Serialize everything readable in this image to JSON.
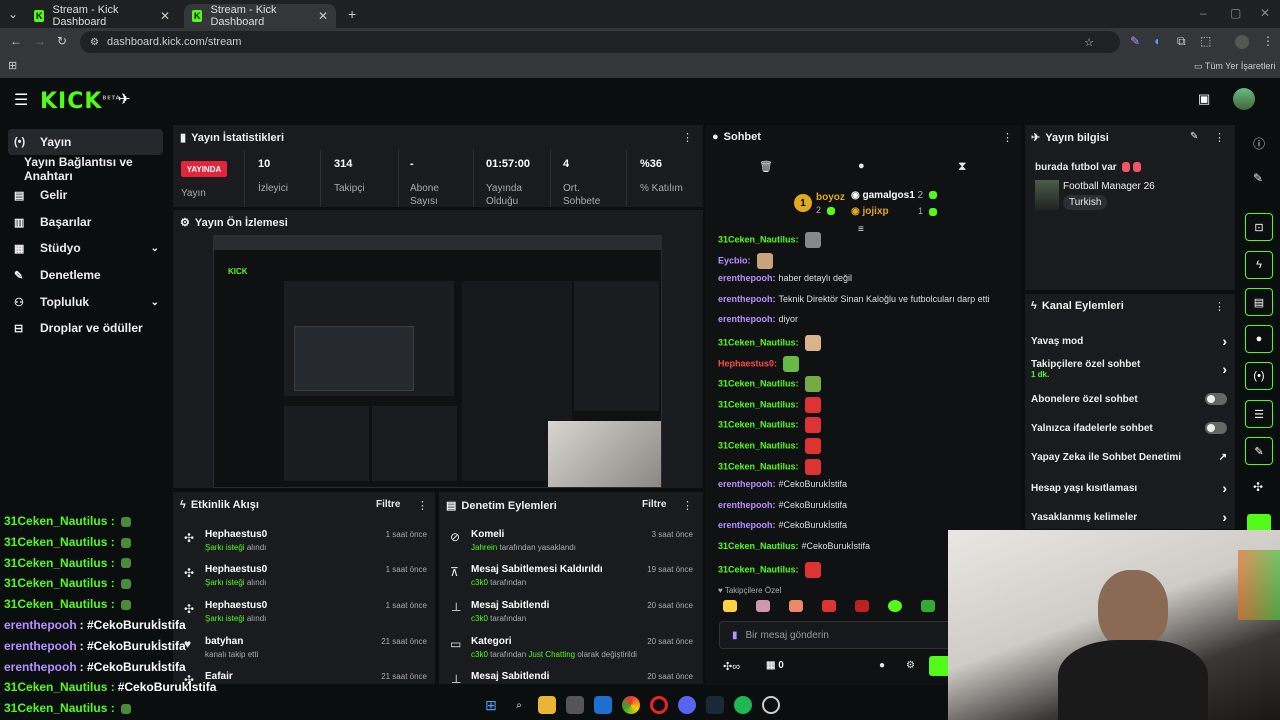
{
  "browser": {
    "tabs": [
      {
        "title": "Stream - Kick Dashboard"
      },
      {
        "title": "Stream - Kick Dashboard"
      }
    ],
    "url": "dashboard.kick.com/stream",
    "bookmarks_label": "Tüm Yer İşaretleri"
  },
  "header": {
    "logo": "KICK",
    "beta": "BETA"
  },
  "sidebar": {
    "items": [
      {
        "label": "Yayın",
        "icon": "broadcast-icon"
      },
      {
        "label": "Yayın Bağlantısı ve Anahtarı",
        "icon": ""
      },
      {
        "label": "Gelir",
        "icon": "money-icon"
      },
      {
        "label": "Başarılar",
        "icon": "trophy-icon"
      },
      {
        "label": "Stüdyo",
        "icon": "studio-icon"
      },
      {
        "label": "Denetleme",
        "icon": "wrench-icon"
      },
      {
        "label": "Topluluk",
        "icon": "people-icon"
      },
      {
        "label": "Droplar ve ödüller",
        "icon": "gift-icon"
      }
    ]
  },
  "stats": {
    "title": "Yayın İstatistikleri",
    "live_badge": "YAYINDA",
    "live_label": "Yayın",
    "items": [
      {
        "value": "10",
        "label": "İzleyici"
      },
      {
        "value": "314",
        "label": "Takipçi"
      },
      {
        "value": "-",
        "label": "Abone Sayısı"
      },
      {
        "value": "01:57:00",
        "label": "Yayında Olduğu"
      },
      {
        "value": "4",
        "label": "Ort. Sohbete"
      },
      {
        "value": "%36",
        "label": "% Katılım"
      }
    ]
  },
  "preview": {
    "title": "Yayın Ön İzlemesi"
  },
  "activity": {
    "title": "Etkinlik Akışı",
    "filter": "Filtre",
    "rows": [
      {
        "user": "Hephaestus0",
        "detail_pre": "Şarkı isteği",
        "detail_post": "alındı",
        "time": "1 saat önce"
      },
      {
        "user": "Hephaestus0",
        "detail_pre": "Şarkı isteği",
        "detail_post": "alındı",
        "time": "1 saat önce"
      },
      {
        "user": "Hephaestus0",
        "detail_pre": "Şarkı isteği",
        "detail_post": "alındı",
        "time": "1 saat önce"
      },
      {
        "user": "batyhan",
        "detail_pre": "",
        "detail_post": "kanalı takip etti",
        "time": "21 saat önce"
      },
      {
        "user": "Eafair",
        "detail_pre": "",
        "detail_post": "",
        "time": "21 saat önce"
      }
    ]
  },
  "audit": {
    "title": "Denetim Eylemleri",
    "filter": "Filtre",
    "rows": [
      {
        "title": "Komeli",
        "actor": "Jahrein",
        "detail": "tarafından yasaklandı",
        "time": "3 saat önce",
        "extra": "",
        "extra2": ""
      },
      {
        "title": "Mesaj Sabitlemesi Kaldırıldı",
        "actor": "c3k0",
        "detail": "tarafından",
        "time": "19 saat önce",
        "extra": "",
        "extra2": ""
      },
      {
        "title": "Mesaj Sabitlendi",
        "actor": "c3k0",
        "detail": "tarafından",
        "time": "20 saat önce",
        "extra": "",
        "extra2": ""
      },
      {
        "title": "Kategori",
        "actor": "c3k0",
        "detail": "tarafından",
        "time": "20 saat önce",
        "extra": "Just Chatting",
        "extra2": "olarak değiştirildi"
      },
      {
        "title": "Mesaj Sabitlendi",
        "actor": "",
        "detail": "",
        "time": "20 saat önce",
        "extra": "",
        "extra2": ""
      }
    ]
  },
  "chat": {
    "title": "Sohbet",
    "leaders": [
      {
        "rank": "1",
        "name": "boyoz",
        "count": "2"
      },
      {
        "rank": "",
        "name": "gamalgos1",
        "count": "2"
      },
      {
        "rank": "",
        "name": "jojixp",
        "count": "1"
      }
    ],
    "messages": [
      {
        "user": "31Ceken_Nautilus:",
        "text": "",
        "color": "green"
      },
      {
        "user": "Eycbio:",
        "text": "",
        "color": "purple"
      },
      {
        "user": "erenthepooh:",
        "text": "haber detaylı değil",
        "color": "purple"
      },
      {
        "user": "erenthepooh:",
        "text": "Teknik Direktör Sinan Kaloğlu ve futbolcuları darp etti",
        "color": "purple"
      },
      {
        "user": "erenthepooh:",
        "text": "diyor",
        "color": "purple"
      },
      {
        "user": "31Ceken_Nautilus:",
        "text": "",
        "color": "green"
      },
      {
        "user": "Hephaestus0:",
        "text": "",
        "color": "red"
      },
      {
        "user": "31Ceken_Nautilus:",
        "text": "",
        "color": "green"
      },
      {
        "user": "31Ceken_Nautilus:",
        "text": "",
        "color": "green"
      },
      {
        "user": "31Ceken_Nautilus:",
        "text": "",
        "color": "green"
      },
      {
        "user": "31Ceken_Nautilus:",
        "text": "",
        "color": "green"
      },
      {
        "user": "31Ceken_Nautilus:",
        "text": "",
        "color": "green"
      },
      {
        "user": "erenthepooh:",
        "text": "#CekoBurukİstifa",
        "color": "purple"
      },
      {
        "user": "erenthepooh:",
        "text": "#CekoBurukİstifa",
        "color": "purple"
      },
      {
        "user": "erenthepooh:",
        "text": "#CekoBurukİstifa",
        "color": "purple"
      },
      {
        "user": "31Ceken_Nautilus:",
        "text": "#CekoBurukİstifa",
        "color": "green"
      },
      {
        "user": "31Ceken_Nautilus:",
        "text": "",
        "color": "green"
      }
    ],
    "followers_only": "Takipçilere Özel",
    "input_placeholder": "Bir mesaj gönderin",
    "counter": "0"
  },
  "stream_info": {
    "title": "Yayın bilgisi",
    "stream_title": "burada futbol var",
    "category": "Football Manager 26",
    "tag": "Turkish"
  },
  "channel_actions": {
    "title": "Kanal Eylemleri",
    "items": [
      {
        "label": "Yavaş mod",
        "sub": "",
        "kind": "arrow"
      },
      {
        "label": "Takipçilere özel sohbet",
        "sub": "1 dk.",
        "kind": "arrow"
      },
      {
        "label": "Abonelere özel sohbet",
        "sub": "",
        "kind": "toggle"
      },
      {
        "label": "Yalnızca ifadelerle sohbet",
        "sub": "",
        "kind": "toggle"
      },
      {
        "label": "Yapay Zeka ile Sohbet Denetimi",
        "sub": "",
        "kind": "external"
      },
      {
        "label": "Hesap yaşı kısıtlaması",
        "sub": "",
        "kind": "arrow"
      },
      {
        "label": "Yasaklanmış kelimeler",
        "sub": "",
        "kind": "arrow"
      }
    ]
  },
  "overlay_chat": [
    {
      "user": "31Ceken_Nautilus :",
      "text": "",
      "color": "green"
    },
    {
      "user": "31Ceken_Nautilus :",
      "text": "",
      "color": "green"
    },
    {
      "user": "31Ceken_Nautilus :",
      "text": "",
      "color": "green"
    },
    {
      "user": "31Ceken_Nautilus :",
      "text": "",
      "color": "green"
    },
    {
      "user": "31Ceken_Nautilus :",
      "text": "",
      "color": "green"
    },
    {
      "user": "erenthepooh",
      "text": ": #CekoBurukİstifa",
      "color": "purple"
    },
    {
      "user": "erenthepooh",
      "text": ": #CekoBurukİstifa",
      "color": "purple"
    },
    {
      "user": "erenthepooh",
      "text": ": #CekoBurukİstifa",
      "color": "purple"
    },
    {
      "user": "31Ceken_Nautilus :",
      "text": "#CekoBurukİstifa",
      "color": "green"
    },
    {
      "user": "31Ceken_Nautilus :",
      "text": "",
      "color": "green"
    }
  ],
  "colors": {
    "accent": "#53fc18",
    "live": "#e3253b",
    "purple": "#b890ff",
    "red": "#ff4b4b"
  }
}
